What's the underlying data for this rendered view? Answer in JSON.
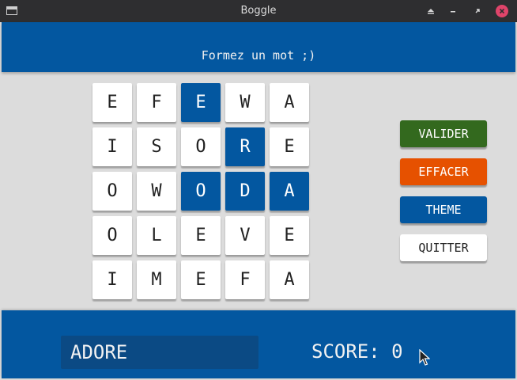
{
  "window": {
    "title": "Boggle",
    "icons": [
      "app-window-icon",
      "shade-icon",
      "minimize-icon",
      "restore-icon",
      "close-icon"
    ]
  },
  "header": {
    "subtitle": "Formez un mot ;)"
  },
  "grid": {
    "rows": [
      [
        "E",
        "F",
        "E",
        "W",
        "A"
      ],
      [
        "I",
        "S",
        "O",
        "R",
        "E"
      ],
      [
        "O",
        "W",
        "O",
        "D",
        "A"
      ],
      [
        "O",
        "L",
        "E",
        "V",
        "E"
      ],
      [
        "I",
        "M",
        "E",
        "F",
        "A"
      ]
    ],
    "selected": [
      [
        0,
        2
      ],
      [
        1,
        3
      ],
      [
        2,
        2
      ],
      [
        2,
        3
      ],
      [
        2,
        4
      ]
    ]
  },
  "buttons": {
    "valider": "VALIDER",
    "effacer": "EFFACER",
    "theme": "THEME",
    "quitter": "QUITTER"
  },
  "footer": {
    "current_word": "ADORE",
    "score_label": "SCORE:",
    "score_value": "0"
  },
  "colors": {
    "primary_blue": "#0357a0",
    "valider_green": "#33691e",
    "effacer_orange": "#e65100",
    "close_red": "#e0446a",
    "background": "#dcdcdc"
  }
}
